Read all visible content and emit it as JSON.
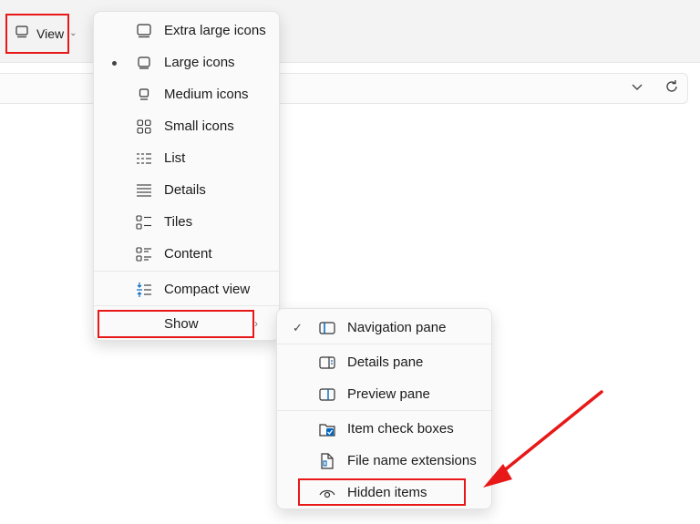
{
  "toolbar": {
    "view_label": "View"
  },
  "colors": {
    "highlight": "#e81818",
    "accent": "#0067c0",
    "arrow": "#e81818"
  },
  "view_menu": {
    "items": [
      {
        "label": "Extra large icons",
        "icon": "monitor-icon",
        "selected": false
      },
      {
        "label": "Large icons",
        "icon": "monitor-icon",
        "selected": true
      },
      {
        "label": "Medium icons",
        "icon": "monitor-small-icon",
        "selected": false
      },
      {
        "label": "Small icons",
        "icon": "grid-icon",
        "selected": false
      },
      {
        "label": "List",
        "icon": "list-icon",
        "selected": false
      },
      {
        "label": "Details",
        "icon": "details-icon",
        "selected": false
      },
      {
        "label": "Tiles",
        "icon": "tiles-icon",
        "selected": false
      },
      {
        "label": "Content",
        "icon": "content-icon",
        "selected": false
      },
      {
        "label": "Compact view",
        "icon": "compact-icon",
        "selected": false
      },
      {
        "label": "Show",
        "icon": "",
        "selected": false
      }
    ]
  },
  "show_menu": {
    "items": [
      {
        "label": "Navigation pane",
        "icon": "navigation-pane-icon",
        "checked": true
      },
      {
        "label": "Details pane",
        "icon": "details-pane-icon",
        "checked": false
      },
      {
        "label": "Preview pane",
        "icon": "preview-pane-icon",
        "checked": false
      },
      {
        "label": "Item check boxes",
        "icon": "checkbox-icon",
        "checked": false
      },
      {
        "label": "File name extensions",
        "icon": "file-icon",
        "checked": false
      },
      {
        "label": "Hidden items",
        "icon": "eye-icon",
        "checked": false
      }
    ]
  }
}
